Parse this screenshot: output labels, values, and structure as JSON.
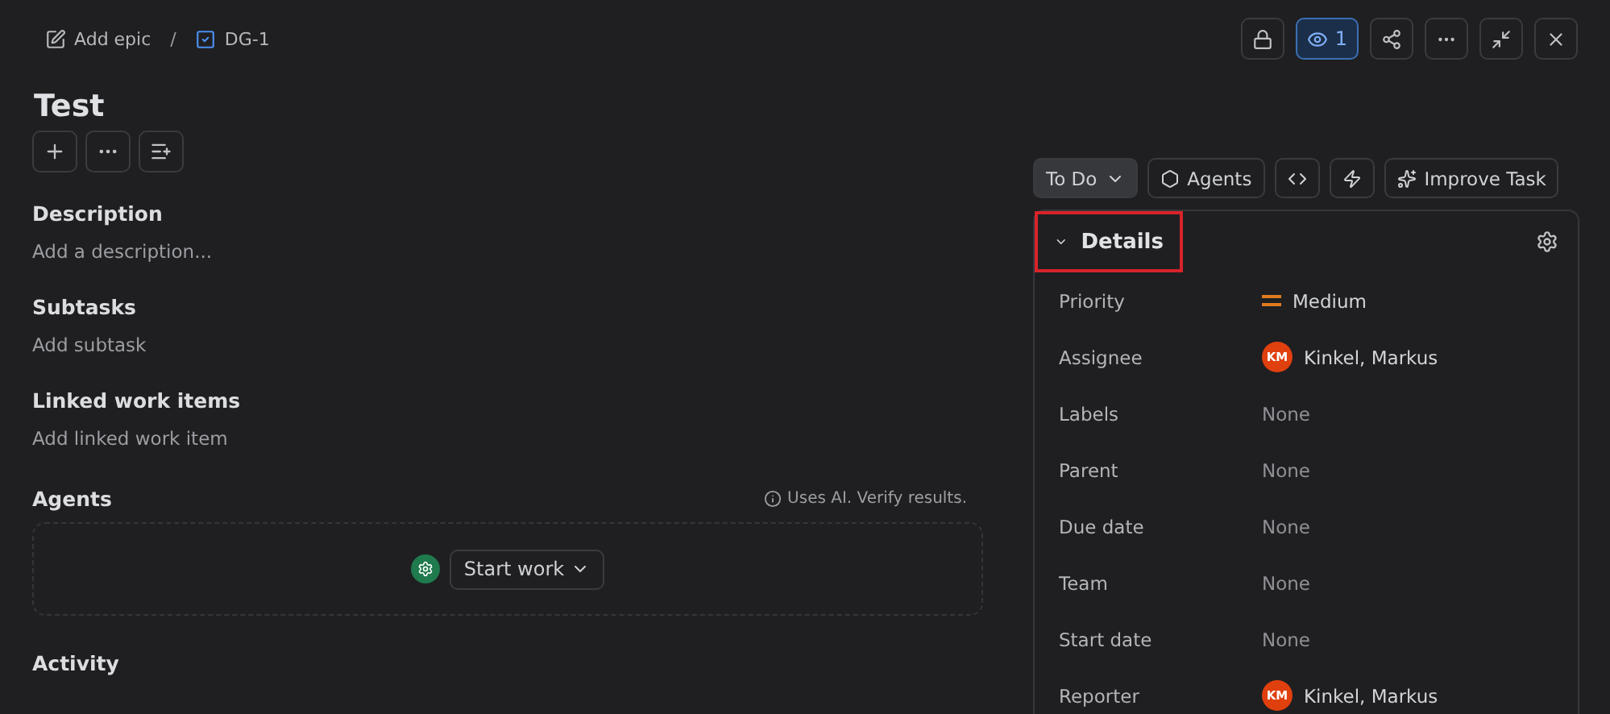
{
  "breadcrumb": [
    {
      "kind": "epic",
      "label": "Add epic"
    },
    {
      "kind": "task",
      "label": "DG-1"
    }
  ],
  "breadcrumb_separator": "/",
  "header_actions": [
    {
      "kind": "lock"
    },
    {
      "kind": "watch",
      "count": "1",
      "selected": true
    },
    {
      "kind": "share"
    },
    {
      "kind": "more"
    },
    {
      "kind": "collapse"
    },
    {
      "kind": "close"
    }
  ],
  "title": "Test",
  "title_actions": [
    {
      "kind": "add"
    },
    {
      "kind": "more"
    },
    {
      "kind": "checklist"
    }
  ],
  "sections": [
    {
      "heading": "Description",
      "placeholder": "Add a description..."
    },
    {
      "heading": "Subtasks",
      "placeholder": "Add subtask"
    },
    {
      "heading": "Linked work items",
      "placeholder": "Add linked work item"
    }
  ],
  "agents": {
    "heading": "Agents",
    "note": "Uses AI. Verify results.",
    "button": "Start work"
  },
  "next_heading": "Activity",
  "toolbar": [
    {
      "kind": "status",
      "label": "To Do"
    },
    {
      "kind": "agents",
      "label": "Agents"
    },
    {
      "kind": "code"
    },
    {
      "kind": "automation"
    },
    {
      "kind": "improve",
      "label": "Improve Task"
    }
  ],
  "details": {
    "title": "Details",
    "expanded": true,
    "highlighted": true,
    "fields": [
      {
        "label": "Priority",
        "kind": "priority",
        "value": "Medium",
        "color": "#e07a1f"
      },
      {
        "label": "Assignee",
        "kind": "user",
        "value": "Kinkel, Markus",
        "initials": "KM"
      },
      {
        "label": "Labels",
        "kind": "none",
        "value": "None"
      },
      {
        "label": "Parent",
        "kind": "none",
        "value": "None"
      },
      {
        "label": "Due date",
        "kind": "none",
        "value": "None"
      },
      {
        "label": "Team",
        "kind": "none",
        "value": "None"
      },
      {
        "label": "Start date",
        "kind": "none",
        "value": "None"
      },
      {
        "label": "Reporter",
        "kind": "user",
        "value": "Kinkel, Markus",
        "initials": "KM"
      }
    ]
  }
}
